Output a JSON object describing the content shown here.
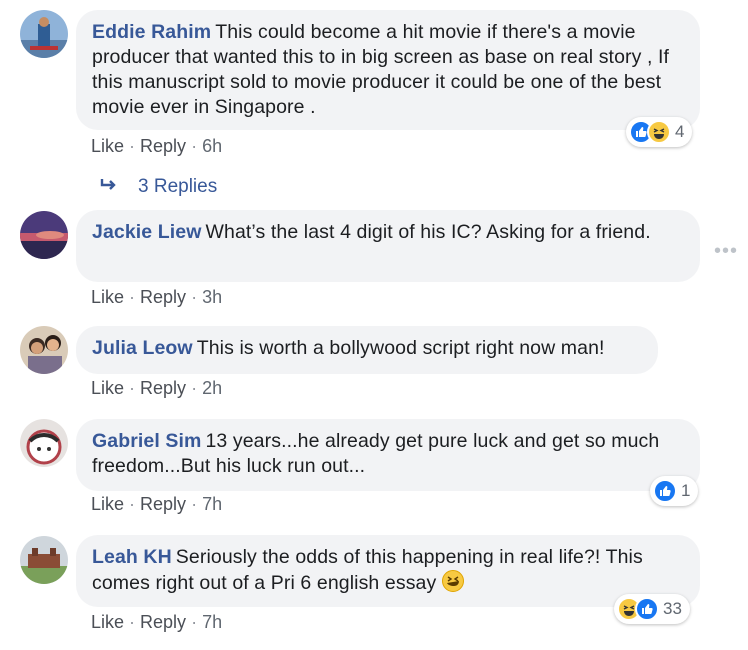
{
  "comments": [
    {
      "author": "Eddie Rahim",
      "text": "This could become a hit movie if there's a movie producer that wanted this to in big screen as base on real story , If this manuscript sold to movie producer it could be one of the best movie ever in Singapore .",
      "like": "Like",
      "reply": "Reply",
      "time": "6h",
      "reaction_count": "4",
      "reaction_icons": [
        "like-icon",
        "haha-icon"
      ]
    },
    {
      "author": "Jackie Liew",
      "text": "What’s the last 4 digit of his IC? Asking for a friend.",
      "like": "Like",
      "reply": "Reply",
      "time": "3h"
    },
    {
      "author": "Julia Leow",
      "text": "This is worth a bollywood script right now man!",
      "like": "Like",
      "reply": "Reply",
      "time": "2h"
    },
    {
      "author": "Gabriel Sim",
      "text": "13 years...he already get pure luck and get so much freedom...But his luck run out...",
      "like": "Like",
      "reply": "Reply",
      "time": "7h",
      "reaction_count": "1",
      "reaction_icons": [
        "like-icon"
      ]
    },
    {
      "author": "Leah KH",
      "text": "Seriously the odds of this happening in real life?! This comes right out of a Pri 6 english essay",
      "like": "Like",
      "reply": "Reply",
      "time": "7h",
      "reaction_count": "33",
      "reaction_icons": [
        "haha-icon",
        "like-icon"
      ]
    }
  ],
  "replies_link": "3 Replies",
  "colors": {
    "author": "#385898",
    "bubble": "#f2f3f5",
    "meta": "#606770",
    "like": "#1877f2",
    "haha": "#f7c942"
  }
}
